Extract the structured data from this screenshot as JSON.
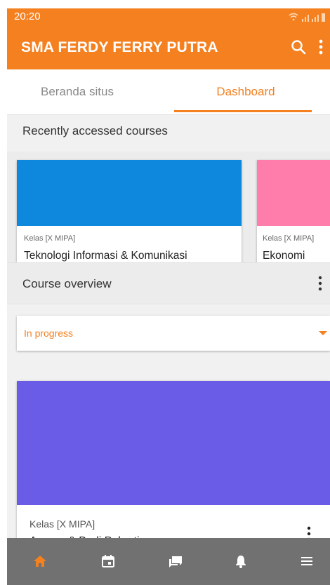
{
  "status_bar": {
    "time": "20:20"
  },
  "app_bar": {
    "title": "SMA FERDY FERRY PUTRA"
  },
  "tabs": [
    {
      "label": "Beranda situs",
      "active": false
    },
    {
      "label": "Dashboard",
      "active": true
    }
  ],
  "recent": {
    "heading": "Recently accessed courses",
    "courses": [
      {
        "category": "Kelas [X MIPA]",
        "name": "Teknologi Informasi & Komunikasi",
        "color": "#0d88dd"
      },
      {
        "category": "Kelas [X MIPA]",
        "name": "Ekonomi",
        "color": "#ff7daa"
      }
    ]
  },
  "overview": {
    "heading": "Course overview",
    "filter_value": "In progress",
    "courses": [
      {
        "category": "Kelas [X MIPA]",
        "name": "Agama & Budi Pekerti",
        "color": "#6b5ce7"
      }
    ]
  },
  "bottom_nav": [
    "home-icon",
    "calendar-icon",
    "messages-icon",
    "notifications-icon",
    "menu-icon"
  ],
  "colors": {
    "accent": "#f48020",
    "nav_bg": "#717171"
  }
}
